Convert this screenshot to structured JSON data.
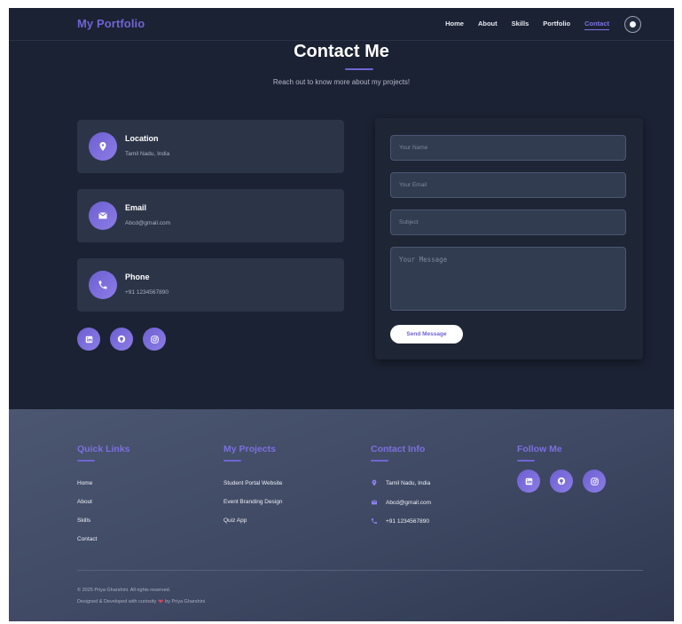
{
  "navbar": {
    "logo": "My Portfolio",
    "links": [
      {
        "label": "Home"
      },
      {
        "label": "About"
      },
      {
        "label": "Skills"
      },
      {
        "label": "Portfolio"
      },
      {
        "label": "Contact",
        "active": true
      }
    ]
  },
  "contact": {
    "title": "Contact Me",
    "subtitle": "Reach out to know more about my projects!",
    "cards": [
      {
        "icon": "location-pin-icon",
        "title": "Location",
        "value": "Tamil Nadu, India"
      },
      {
        "icon": "email-icon",
        "title": "Email",
        "value": "Abcd@gmail.com"
      },
      {
        "icon": "phone-icon",
        "title": "Phone",
        "value": "+91 1234567890"
      }
    ],
    "social": [
      "linkedin-icon",
      "github-icon",
      "instagram-icon"
    ]
  },
  "form": {
    "name_placeholder": "Your Name",
    "email_placeholder": "Your Email",
    "subject_placeholder": "Subject",
    "message_placeholder": "Your Message",
    "send_label": "Send Message"
  },
  "footer": {
    "quick_links": {
      "heading": "Quick Links",
      "items": [
        "Home",
        "About",
        "Skills",
        "Contact"
      ]
    },
    "projects": {
      "heading": "My Projects",
      "items": [
        "Student Portal Website",
        "Event Branding Design",
        "Quiz App"
      ]
    },
    "contact_info": {
      "heading": "Contact Info",
      "items": [
        "Tamil Nadu, India",
        "Abcd@gmail.com",
        "+91 1234567890"
      ]
    },
    "follow": {
      "heading": "Follow Me"
    },
    "copyright": "© 2025 Priya Gharshini. All rights reserved.",
    "credit_before": "Designed & Developed with curiosity",
    "credit_after": "by Priya Gharshini"
  },
  "colors": {
    "accent": "#6f64d4",
    "background": "#1b2233",
    "card": "#2c3548",
    "heart": "#e0425b"
  }
}
